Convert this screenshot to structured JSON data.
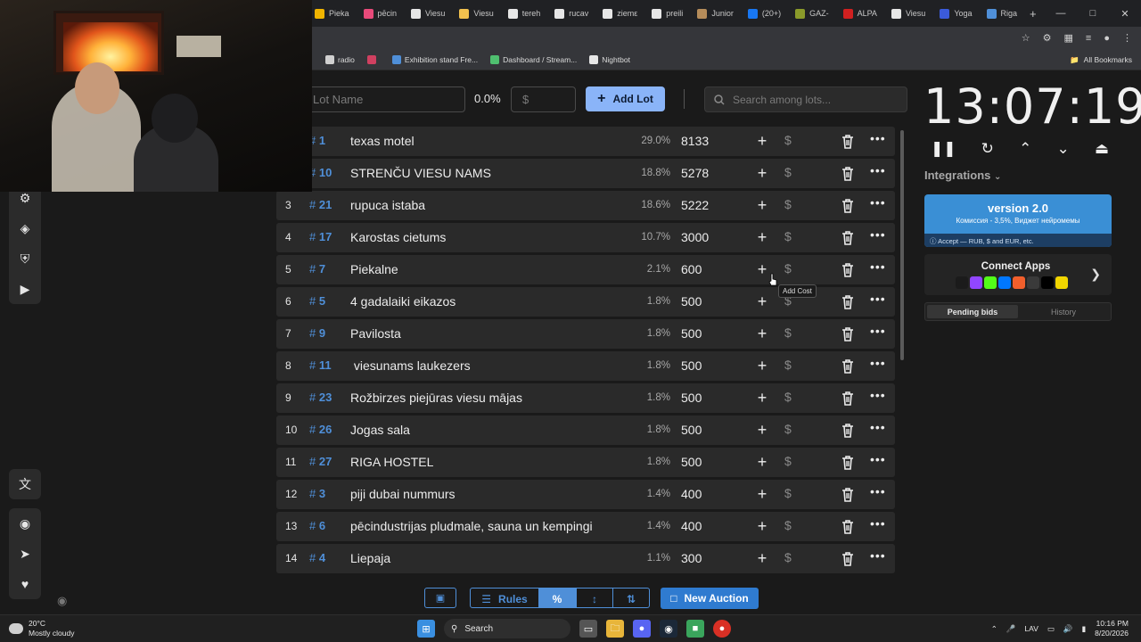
{
  "browser": {
    "tabs": [
      {
        "label": "Pieka",
        "color": "#f0b400"
      },
      {
        "label": "pēcin",
        "color": "#e84a7a"
      },
      {
        "label": "Viesu",
        "color": "#e6e6e6"
      },
      {
        "label": "Viesu",
        "color": "#f2c14e"
      },
      {
        "label": "tereh",
        "color": "#e6e6e6"
      },
      {
        "label": "rucav",
        "color": "#e6e6e6"
      },
      {
        "label": "ziemε",
        "color": "#e6e6e6"
      },
      {
        "label": "preili",
        "color": "#e6e6e6"
      },
      {
        "label": "Junior",
        "color": "#b58c5a"
      },
      {
        "label": "(20+)",
        "color": "#1877f2"
      },
      {
        "label": "GAZ-",
        "color": "#8a9a2a"
      },
      {
        "label": "ALPA",
        "color": "#d02020"
      },
      {
        "label": "Viesu",
        "color": "#e6e6e6"
      },
      {
        "label": "Yoga",
        "color": "#3b5bdb"
      },
      {
        "label": "Riga",
        "color": "#4f8fd8"
      }
    ],
    "bookmarks": [
      {
        "label": "radio",
        "color": "#d0d0d0"
      },
      {
        "label": "",
        "color": "#d04060"
      },
      {
        "label": "Exhibition stand Fre...",
        "color": "#4f8fd8"
      },
      {
        "label": "Dashboard / Stream...",
        "color": "#4fbf6f"
      },
      {
        "label": "Nightbot",
        "color": "#e6e6e6"
      }
    ],
    "all_bookmarks": "All Bookmarks"
  },
  "toolbar": {
    "lot_name_placeholder": "Lot Name",
    "percent": "0.0%",
    "amount_placeholder": "$",
    "add_lot": "Add Lot",
    "search_placeholder": "Search among lots..."
  },
  "lots": [
    {
      "num": "",
      "id": "1",
      "name": "texas motel",
      "percent": "29.0%",
      "amount": "8133"
    },
    {
      "num": "",
      "id": "10",
      "name": "STRENČU VIESU NAMS",
      "percent": "18.8%",
      "amount": "5278"
    },
    {
      "num": "3",
      "id": "21",
      "name": "rupuca istaba",
      "percent": "18.6%",
      "amount": "5222"
    },
    {
      "num": "4",
      "id": "17",
      "name": "Karostas cietums",
      "percent": "10.7%",
      "amount": "3000"
    },
    {
      "num": "5",
      "id": "7",
      "name": "Piekalne",
      "percent": "2.1%",
      "amount": "600"
    },
    {
      "num": "6",
      "id": "5",
      "name": "4 gadalaiki eikazos",
      "percent": "1.8%",
      "amount": "500"
    },
    {
      "num": "7",
      "id": "9",
      "name": "Pavilosta",
      "percent": "1.8%",
      "amount": "500"
    },
    {
      "num": "8",
      "id": "11",
      "name": " viesunams laukezers",
      "percent": "1.8%",
      "amount": "500"
    },
    {
      "num": "9",
      "id": "23",
      "name": "Rožbirzes piejūras viesu mājas",
      "percent": "1.8%",
      "amount": "500"
    },
    {
      "num": "10",
      "id": "26",
      "name": "Jogas sala",
      "percent": "1.8%",
      "amount": "500"
    },
    {
      "num": "11",
      "id": "27",
      "name": "RIGA HOSTEL",
      "percent": "1.8%",
      "amount": "500"
    },
    {
      "num": "12",
      "id": "3",
      "name": "piji dubai nummurs",
      "percent": "1.4%",
      "amount": "400"
    },
    {
      "num": "13",
      "id": "6",
      "name": "pēcindustrijas pludmale, sauna un kempingi",
      "percent": "1.4%",
      "amount": "400"
    },
    {
      "num": "14",
      "id": "4",
      "name": "Liepaja",
      "percent": "1.1%",
      "amount": "300"
    }
  ],
  "tooltip": "Add Cost",
  "bottom": {
    "rules": "Rules",
    "new_auction": "New Auction"
  },
  "right": {
    "timer": "13:07:19",
    "integrations": "Integrations",
    "version_title": "version 2.0",
    "version_sub": "Комиссия - 3,5%, Виджет нейромемы",
    "version_foot": "Accept — RUB, $ and EUR, etc.",
    "connect_apps": "Connect Apps",
    "pending_bids": "Pending bids",
    "history": "History"
  },
  "taskbar": {
    "temp": "20°C",
    "weather": "Mostly cloudy",
    "search": "Search",
    "lang": "LAV",
    "time": "10:16 PM",
    "date": "8/20/2026"
  },
  "colors": {
    "accent": "#4f8fd8",
    "add_lot_bg": "#8ab4f8",
    "new_auction_bg": "#2f7bd0",
    "version_card": "#3a8fd5",
    "row_bg": "#2a2a2a"
  }
}
